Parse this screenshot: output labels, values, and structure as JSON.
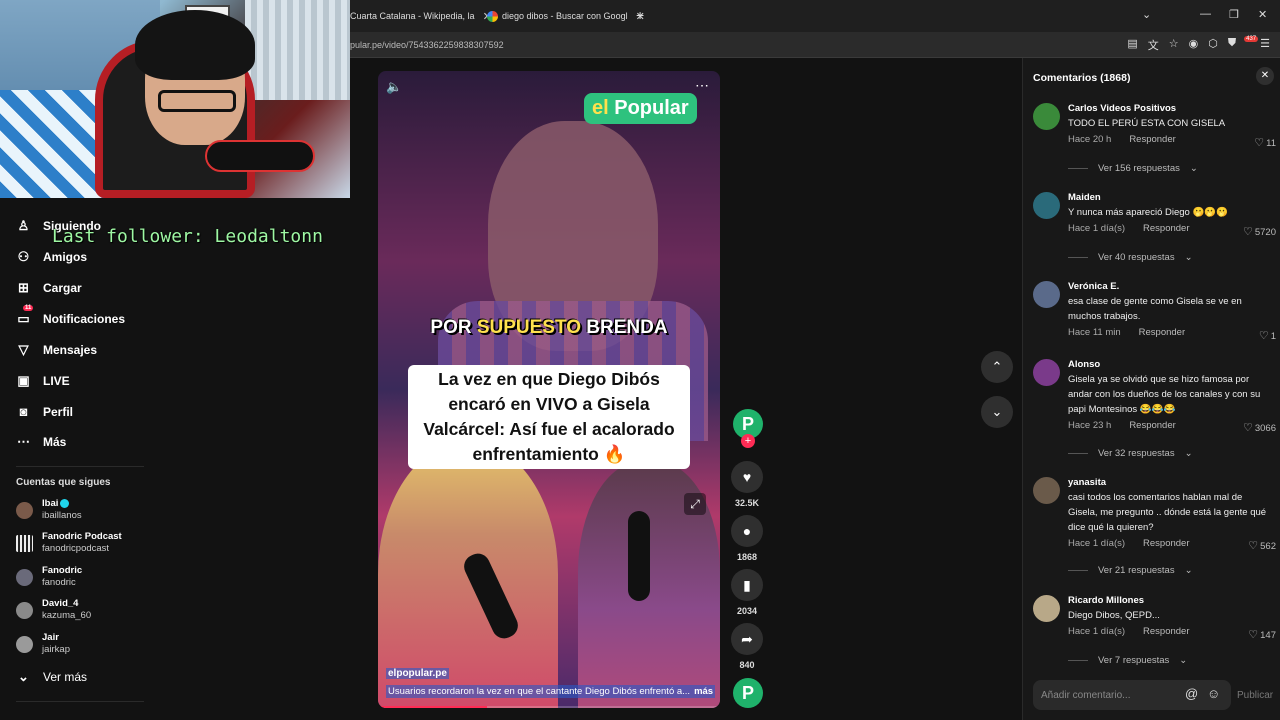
{
  "browser": {
    "tabs": [
      {
        "label": "Cuarta Catalana - Wikipedia, la"
      },
      {
        "label": "diego dibos - Buscar con Googl"
      }
    ],
    "url": "pular.pe/video/7543362259838307592",
    "extensions_badge": "437"
  },
  "overlay": {
    "last_follower": "Last follower: Leodaltonn"
  },
  "sidebar": {
    "nav": [
      {
        "label": "Siguiendo",
        "icon": "following-icon"
      },
      {
        "label": "Amigos",
        "icon": "friends-icon"
      },
      {
        "label": "Cargar",
        "icon": "upload-icon"
      },
      {
        "label": "Notificaciones",
        "icon": "notifications-icon",
        "badge": "11"
      },
      {
        "label": "Mensajes",
        "icon": "messages-icon"
      },
      {
        "label": "LIVE",
        "icon": "live-icon"
      },
      {
        "label": "Perfil",
        "icon": "profile-icon"
      },
      {
        "label": "Más",
        "icon": "more-icon"
      }
    ],
    "following_title": "Cuentas que sigues",
    "accounts": [
      {
        "name": "Ibai",
        "handle": "ibaillanos",
        "verified": true
      },
      {
        "name": "Fanodric Podcast",
        "handle": "fanodricpodcast"
      },
      {
        "name": "Fanodric",
        "handle": "fanodric"
      },
      {
        "name": "David_4",
        "handle": "kazuma_60"
      },
      {
        "name": "Jair",
        "handle": "jairkap"
      }
    ],
    "see_more": "Ver más"
  },
  "video": {
    "brand_logo_prefix": "el",
    "brand_logo_name": "Popular",
    "banner_pre": "POR ",
    "banner_highlight": "SUPUESTO",
    "banner_post": " BRENDA",
    "headline": "La vez en que Diego Dibós encaró en VIVO a Gisela Valcárcel: Así fue el acalorado enfrentamiento 🔥",
    "author": "elpopular.pe",
    "description": "Usuarios recordaron la vez en que el cantante Diego Dibós enfrentó a...",
    "more": "más",
    "progress": 0.32
  },
  "actions": {
    "avatar_letter": "P",
    "likes": "32.5K",
    "comments": "1868",
    "saves": "2034",
    "shares": "840"
  },
  "comments_panel": {
    "title": "Comentarios (1868)",
    "input_placeholder": "Añadir comentario...",
    "publish": "Publicar",
    "reply_label": "Responder",
    "items": [
      {
        "user": "Carlos Videos Positivos",
        "text": "TODO EL PERÚ ESTA CON GISELA",
        "time": "Hace 20 h",
        "likes": "11",
        "replies": "Ver 156 respuestas",
        "avatar_color": "#3a8a3a"
      },
      {
        "user": "Maiden",
        "text": "Y nunca más apareció Diego 🫢🫢🫢",
        "time": "Hace 1 día(s)",
        "likes": "5720",
        "replies": "Ver 40 respuestas",
        "avatar_color": "#2a6a7a"
      },
      {
        "user": "Verónica E.",
        "text": "esa clase de gente como Gisela se ve en muchos trabajos.",
        "time": "Hace 11 min",
        "likes": "1",
        "replies": "",
        "avatar_color": "#5a6a8a"
      },
      {
        "user": "Alonso",
        "text": "Gisela ya se olvidó que se hizo famosa por andar con los dueños de los canales y con su papi Montesinos 😂😂😂",
        "time": "Hace 23 h",
        "likes": "3066",
        "replies": "Ver 32 respuestas",
        "avatar_color": "#7a3a8a"
      },
      {
        "user": "yanasita",
        "text": "casi todos los comentarios hablan mal de Gisela, me pregunto .. dónde está la gente qué dice qué la quieren?",
        "time": "Hace 1 día(s)",
        "likes": "562",
        "replies": "Ver 21 respuestas",
        "avatar_color": "#6a5a4a"
      },
      {
        "user": "Ricardo Millones",
        "text": "Diego Dibos, QEPD...",
        "time": "Hace 1 día(s)",
        "likes": "147",
        "replies": "Ver 7 respuestas",
        "avatar_color": "#b8a888"
      }
    ]
  }
}
